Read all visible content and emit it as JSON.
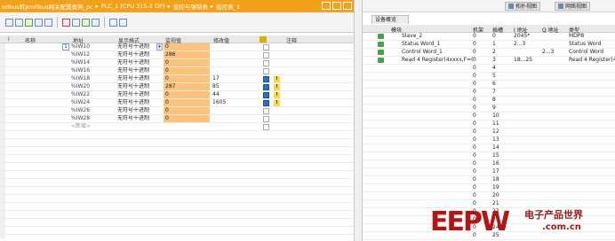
{
  "breadcrumb": {
    "items": [
      "odbus转profibus网关配置案例_pc",
      "PLC_1 [CPU 315-2 DP]",
      "监控与强制表",
      "监控表_1"
    ],
    "separator": "▸"
  },
  "left_table": {
    "headers": {
      "index": "i",
      "name": "名称",
      "address": "地址",
      "display_format": "显示格式",
      "monitor_value": "监视值",
      "modify_value": "修改值",
      "flag": "",
      "comment": "注释"
    },
    "rows": [
      {
        "address": "%IW10",
        "format": "无符号十进制",
        "monitor": "0",
        "modify": "",
        "checked": false,
        "warn": false
      },
      {
        "address": "%IW12",
        "format": "无符号十进制",
        "monitor": "286",
        "modify": "",
        "checked": false,
        "warn": false
      },
      {
        "address": "%IW14",
        "format": "无符号十进制",
        "monitor": "0",
        "modify": "",
        "checked": false,
        "warn": false
      },
      {
        "address": "%IW16",
        "format": "无符号十进制",
        "monitor": "0",
        "modify": "",
        "checked": false,
        "warn": false
      },
      {
        "address": "%IW18",
        "format": "无符号十进制",
        "monitor": "0",
        "modify": "17",
        "checked": true,
        "warn": true
      },
      {
        "address": "%IW20",
        "format": "无符号十进制",
        "monitor": "287",
        "modify": "85",
        "checked": true,
        "warn": true
      },
      {
        "address": "%IW22",
        "format": "无符号十进制",
        "monitor": "0",
        "modify": "44",
        "checked": true,
        "warn": true
      },
      {
        "address": "%IW24",
        "format": "无符号十进制",
        "monitor": "0",
        "modify": "1605",
        "checked": true,
        "warn": true
      },
      {
        "address": "%IW26",
        "format": "无符号十进制",
        "monitor": "0",
        "modify": "",
        "checked": false,
        "warn": false
      },
      {
        "address": "%IW28",
        "format": "无符号十进制",
        "monitor": "0",
        "modify": "",
        "checked": false,
        "warn": false
      }
    ],
    "new_row_label": "<新增>",
    "warn_symbol": "!"
  },
  "right_panel": {
    "view_buttons": [
      "拓扑视图",
      "网络视图"
    ],
    "tab": "设备概览",
    "headers": {
      "module": "模块",
      "rack": "机架",
      "slot": "插槽",
      "i_address": "I 地址",
      "q_address": "Q 地址",
      "type": "类型"
    },
    "rows": [
      {
        "checked": true,
        "module": "Slave_2",
        "rack": "0",
        "slot": "0",
        "i_address": "2045*",
        "q_address": "",
        "type": "MDP8"
      },
      {
        "checked": true,
        "module": "Status Word_1",
        "rack": "0",
        "slot": "1",
        "i_address": "2...3",
        "q_address": "",
        "type": "Status Word"
      },
      {
        "checked": true,
        "module": "Control Word_1",
        "rack": "0",
        "slot": "2",
        "i_address": "",
        "q_address": "2...3",
        "type": "Control Word"
      },
      {
        "checked": true,
        "module": "Read 4 Register(4xxxx,F=03...",
        "rack": "0",
        "slot": "3",
        "i_address": "18...25",
        "q_address": "",
        "type": "Read 4 Register(4xx..."
      },
      {
        "checked": false,
        "module": "",
        "rack": "0",
        "slot": "4",
        "i_address": "",
        "q_address": "",
        "type": ""
      },
      {
        "checked": false,
        "module": "",
        "rack": "0",
        "slot": "5",
        "i_address": "",
        "q_address": "",
        "type": ""
      },
      {
        "checked": false,
        "module": "",
        "rack": "0",
        "slot": "6",
        "i_address": "",
        "q_address": "",
        "type": ""
      },
      {
        "checked": false,
        "module": "",
        "rack": "0",
        "slot": "7",
        "i_address": "",
        "q_address": "",
        "type": ""
      },
      {
        "checked": false,
        "module": "",
        "rack": "0",
        "slot": "8",
        "i_address": "",
        "q_address": "",
        "type": ""
      },
      {
        "checked": false,
        "module": "",
        "rack": "0",
        "slot": "9",
        "i_address": "",
        "q_address": "",
        "type": ""
      },
      {
        "checked": false,
        "module": "",
        "rack": "0",
        "slot": "10",
        "i_address": "",
        "q_address": "",
        "type": ""
      },
      {
        "checked": false,
        "module": "",
        "rack": "0",
        "slot": "11",
        "i_address": "",
        "q_address": "",
        "type": ""
      },
      {
        "checked": false,
        "module": "",
        "rack": "0",
        "slot": "12",
        "i_address": "",
        "q_address": "",
        "type": ""
      },
      {
        "checked": false,
        "module": "",
        "rack": "0",
        "slot": "13",
        "i_address": "",
        "q_address": "",
        "type": ""
      },
      {
        "checked": false,
        "module": "",
        "rack": "0",
        "slot": "14",
        "i_address": "",
        "q_address": "",
        "type": ""
      },
      {
        "checked": false,
        "module": "",
        "rack": "0",
        "slot": "15",
        "i_address": "",
        "q_address": "",
        "type": ""
      },
      {
        "checked": false,
        "module": "",
        "rack": "0",
        "slot": "16",
        "i_address": "",
        "q_address": "",
        "type": ""
      },
      {
        "checked": false,
        "module": "",
        "rack": "0",
        "slot": "17",
        "i_address": "",
        "q_address": "",
        "type": ""
      },
      {
        "checked": false,
        "module": "",
        "rack": "0",
        "slot": "18",
        "i_address": "",
        "q_address": "",
        "type": ""
      },
      {
        "checked": false,
        "module": "",
        "rack": "0",
        "slot": "19",
        "i_address": "",
        "q_address": "",
        "type": ""
      },
      {
        "checked": false,
        "module": "",
        "rack": "0",
        "slot": "20",
        "i_address": "",
        "q_address": "",
        "type": ""
      },
      {
        "checked": false,
        "module": "",
        "rack": "0",
        "slot": "21",
        "i_address": "",
        "q_address": "",
        "type": ""
      },
      {
        "checked": false,
        "module": "",
        "rack": "0",
        "slot": "22",
        "i_address": "",
        "q_address": "",
        "type": ""
      },
      {
        "checked": false,
        "module": "",
        "rack": "0",
        "slot": "23",
        "i_address": "",
        "q_address": "",
        "type": ""
      },
      {
        "checked": false,
        "module": "",
        "rack": "0",
        "slot": "24",
        "i_address": "",
        "q_address": "",
        "type": ""
      },
      {
        "checked": false,
        "module": "",
        "rack": "0",
        "slot": "25",
        "i_address": "",
        "q_address": "",
        "type": ""
      }
    ]
  },
  "watermark": {
    "logo": "EEPW",
    "cn": "电子产品世界",
    "url": ".com.cn"
  },
  "colors": {
    "accent": "#f3a11b",
    "monitor_highlight": "#ffc27a",
    "check_green": "#44a344",
    "brand_red": "#b51414"
  }
}
